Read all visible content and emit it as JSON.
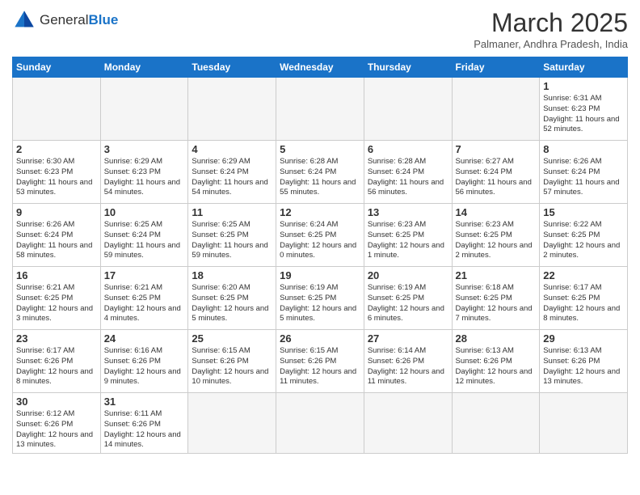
{
  "header": {
    "logo_general": "General",
    "logo_blue": "Blue",
    "month_title": "March 2025",
    "subtitle": "Palmaner, Andhra Pradesh, India"
  },
  "days_of_week": [
    "Sunday",
    "Monday",
    "Tuesday",
    "Wednesday",
    "Thursday",
    "Friday",
    "Saturday"
  ],
  "weeks": [
    [
      {
        "day": "",
        "info": ""
      },
      {
        "day": "",
        "info": ""
      },
      {
        "day": "",
        "info": ""
      },
      {
        "day": "",
        "info": ""
      },
      {
        "day": "",
        "info": ""
      },
      {
        "day": "",
        "info": ""
      },
      {
        "day": "1",
        "info": "Sunrise: 6:31 AM\nSunset: 6:23 PM\nDaylight: 11 hours and 52 minutes."
      }
    ],
    [
      {
        "day": "2",
        "info": "Sunrise: 6:30 AM\nSunset: 6:23 PM\nDaylight: 11 hours and 53 minutes."
      },
      {
        "day": "3",
        "info": "Sunrise: 6:29 AM\nSunset: 6:23 PM\nDaylight: 11 hours and 54 minutes."
      },
      {
        "day": "4",
        "info": "Sunrise: 6:29 AM\nSunset: 6:24 PM\nDaylight: 11 hours and 54 minutes."
      },
      {
        "day": "5",
        "info": "Sunrise: 6:28 AM\nSunset: 6:24 PM\nDaylight: 11 hours and 55 minutes."
      },
      {
        "day": "6",
        "info": "Sunrise: 6:28 AM\nSunset: 6:24 PM\nDaylight: 11 hours and 56 minutes."
      },
      {
        "day": "7",
        "info": "Sunrise: 6:27 AM\nSunset: 6:24 PM\nDaylight: 11 hours and 56 minutes."
      },
      {
        "day": "8",
        "info": "Sunrise: 6:26 AM\nSunset: 6:24 PM\nDaylight: 11 hours and 57 minutes."
      }
    ],
    [
      {
        "day": "9",
        "info": "Sunrise: 6:26 AM\nSunset: 6:24 PM\nDaylight: 11 hours and 58 minutes."
      },
      {
        "day": "10",
        "info": "Sunrise: 6:25 AM\nSunset: 6:24 PM\nDaylight: 11 hours and 59 minutes."
      },
      {
        "day": "11",
        "info": "Sunrise: 6:25 AM\nSunset: 6:25 PM\nDaylight: 11 hours and 59 minutes."
      },
      {
        "day": "12",
        "info": "Sunrise: 6:24 AM\nSunset: 6:25 PM\nDaylight: 12 hours and 0 minutes."
      },
      {
        "day": "13",
        "info": "Sunrise: 6:23 AM\nSunset: 6:25 PM\nDaylight: 12 hours and 1 minute."
      },
      {
        "day": "14",
        "info": "Sunrise: 6:23 AM\nSunset: 6:25 PM\nDaylight: 12 hours and 2 minutes."
      },
      {
        "day": "15",
        "info": "Sunrise: 6:22 AM\nSunset: 6:25 PM\nDaylight: 12 hours and 2 minutes."
      }
    ],
    [
      {
        "day": "16",
        "info": "Sunrise: 6:21 AM\nSunset: 6:25 PM\nDaylight: 12 hours and 3 minutes."
      },
      {
        "day": "17",
        "info": "Sunrise: 6:21 AM\nSunset: 6:25 PM\nDaylight: 12 hours and 4 minutes."
      },
      {
        "day": "18",
        "info": "Sunrise: 6:20 AM\nSunset: 6:25 PM\nDaylight: 12 hours and 5 minutes."
      },
      {
        "day": "19",
        "info": "Sunrise: 6:19 AM\nSunset: 6:25 PM\nDaylight: 12 hours and 5 minutes."
      },
      {
        "day": "20",
        "info": "Sunrise: 6:19 AM\nSunset: 6:25 PM\nDaylight: 12 hours and 6 minutes."
      },
      {
        "day": "21",
        "info": "Sunrise: 6:18 AM\nSunset: 6:25 PM\nDaylight: 12 hours and 7 minutes."
      },
      {
        "day": "22",
        "info": "Sunrise: 6:17 AM\nSunset: 6:25 PM\nDaylight: 12 hours and 8 minutes."
      }
    ],
    [
      {
        "day": "23",
        "info": "Sunrise: 6:17 AM\nSunset: 6:26 PM\nDaylight: 12 hours and 8 minutes."
      },
      {
        "day": "24",
        "info": "Sunrise: 6:16 AM\nSunset: 6:26 PM\nDaylight: 12 hours and 9 minutes."
      },
      {
        "day": "25",
        "info": "Sunrise: 6:15 AM\nSunset: 6:26 PM\nDaylight: 12 hours and 10 minutes."
      },
      {
        "day": "26",
        "info": "Sunrise: 6:15 AM\nSunset: 6:26 PM\nDaylight: 12 hours and 11 minutes."
      },
      {
        "day": "27",
        "info": "Sunrise: 6:14 AM\nSunset: 6:26 PM\nDaylight: 12 hours and 11 minutes."
      },
      {
        "day": "28",
        "info": "Sunrise: 6:13 AM\nSunset: 6:26 PM\nDaylight: 12 hours and 12 minutes."
      },
      {
        "day": "29",
        "info": "Sunrise: 6:13 AM\nSunset: 6:26 PM\nDaylight: 12 hours and 13 minutes."
      }
    ],
    [
      {
        "day": "30",
        "info": "Sunrise: 6:12 AM\nSunset: 6:26 PM\nDaylight: 12 hours and 13 minutes."
      },
      {
        "day": "31",
        "info": "Sunrise: 6:11 AM\nSunset: 6:26 PM\nDaylight: 12 hours and 14 minutes."
      },
      {
        "day": "",
        "info": ""
      },
      {
        "day": "",
        "info": ""
      },
      {
        "day": "",
        "info": ""
      },
      {
        "day": "",
        "info": ""
      },
      {
        "day": "",
        "info": ""
      }
    ]
  ]
}
